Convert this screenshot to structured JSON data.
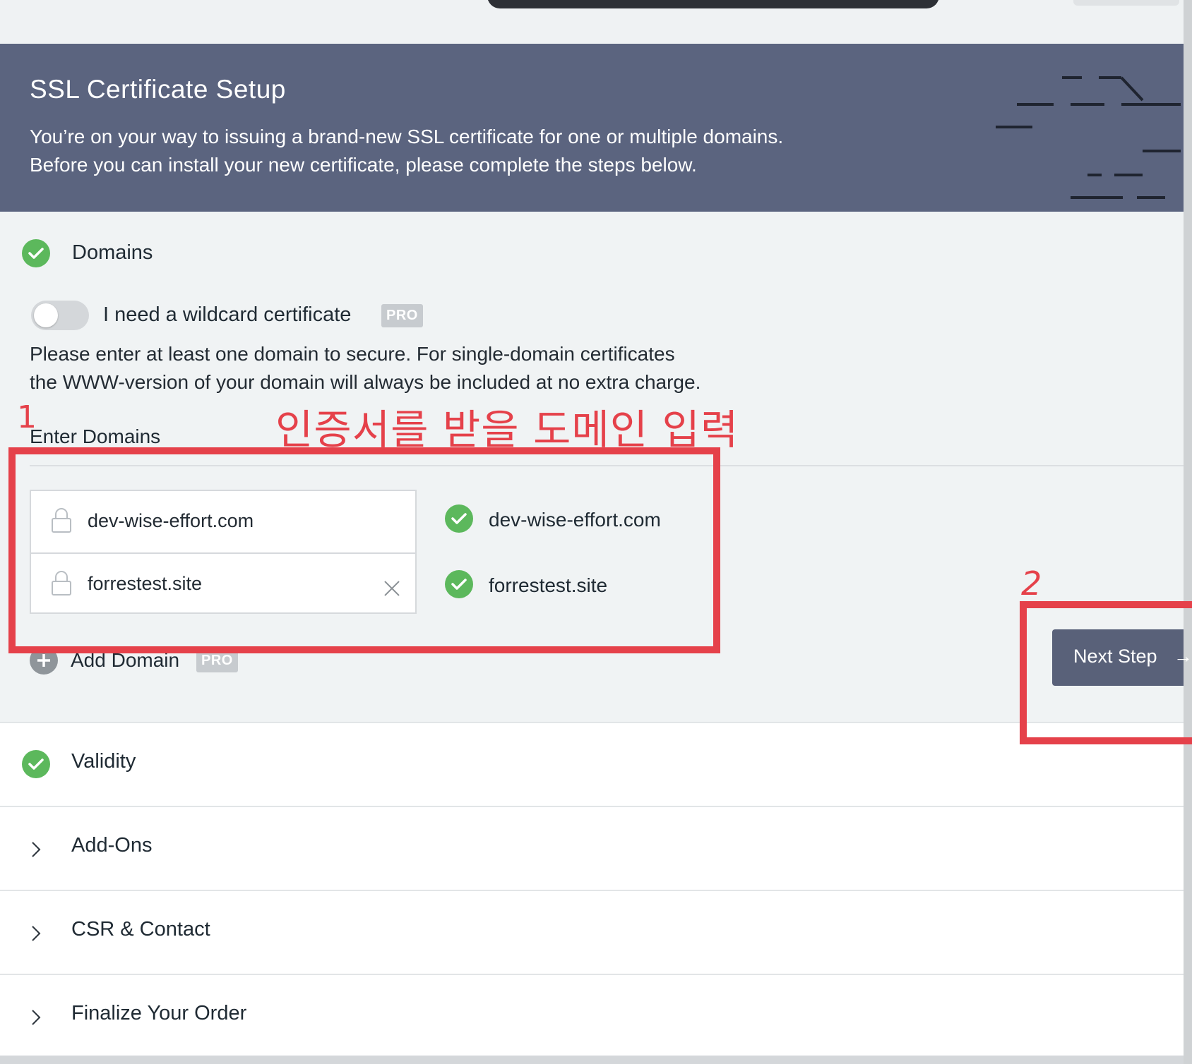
{
  "banner": {
    "title": "SSL Certificate Setup",
    "line1": "You’re on your way to issuing a brand-new SSL certificate for one or multiple domains.",
    "line2": "Before you can install your new certificate, please complete the steps below."
  },
  "domains_step": {
    "title": "Domains",
    "wildcard_label": "I need a wildcard certificate",
    "wildcard_enabled": false,
    "pro_badge": "PRO",
    "desc_line1": "Please enter at least one domain to secure. For single-domain certificates",
    "desc_line2": "the WWW-version of your domain will always be included at no extra charge.",
    "enter_domains_label": "Enter Domains",
    "inputs": [
      {
        "value": "dev-wise-effort.com"
      },
      {
        "value": "forrestest.site"
      }
    ],
    "validated": [
      {
        "label": "dev-wise-effort.com"
      },
      {
        "label": "forrestest.site"
      }
    ],
    "add_domain_label": "Add Domain",
    "add_domain_badge": "PRO",
    "next_button": "Next Step",
    "next_arrow": "→"
  },
  "steps": [
    {
      "title": "Validity",
      "icon": "check-circle-icon"
    },
    {
      "title": "Add-Ons",
      "icon": "chevron-right-icon"
    },
    {
      "title": "CSR & Contact",
      "icon": "chevron-right-icon"
    },
    {
      "title": "Finalize Your Order",
      "icon": "chevron-right-icon"
    }
  ],
  "annotations": {
    "marker1": "1",
    "caption": "인증서를 받을 도메인 입력",
    "marker2": "2",
    "color": "#e5414a"
  },
  "colors": {
    "banner": "#5b647f",
    "check": "#5cb85c",
    "button": "#596179"
  }
}
